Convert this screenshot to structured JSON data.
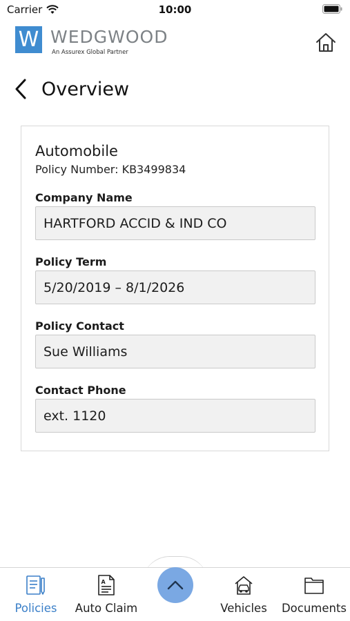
{
  "status_bar": {
    "carrier": "Carrier",
    "time": "10:00"
  },
  "header": {
    "logo_mark": "W",
    "logo_name": "WEDGWOOD",
    "logo_tagline": "An Assurex Global Partner",
    "home_icon": "home-icon"
  },
  "page": {
    "title": "Overview",
    "back_icon": "chevron-left-icon"
  },
  "policy": {
    "type": "Automobile",
    "number_text": "Policy Number: KB3499834",
    "fields": [
      {
        "label": "Company Name",
        "value": "HARTFORD ACCID & IND CO"
      },
      {
        "label": "Policy Term",
        "value": "5/20/2019 – 8/1/2026"
      },
      {
        "label": "Policy Contact",
        "value": "Sue Williams"
      },
      {
        "label": "Contact Phone",
        "value": "ext. 1120"
      }
    ]
  },
  "tab_bar": {
    "items": [
      {
        "label": "Policies",
        "icon": "policies-icon",
        "active": true
      },
      {
        "label": "Auto Claim",
        "icon": "auto-claim-icon",
        "active": false
      },
      {
        "label": "Vehicles",
        "icon": "vehicles-icon",
        "active": false
      },
      {
        "label": "Documents",
        "icon": "documents-icon",
        "active": false
      }
    ],
    "center_icon": "chevron-up-icon"
  },
  "colors": {
    "brand": "#3f8cd0",
    "active_tab": "#3a7fc8",
    "fab": "#7aa8e3",
    "field_bg": "#f1f1f1"
  }
}
